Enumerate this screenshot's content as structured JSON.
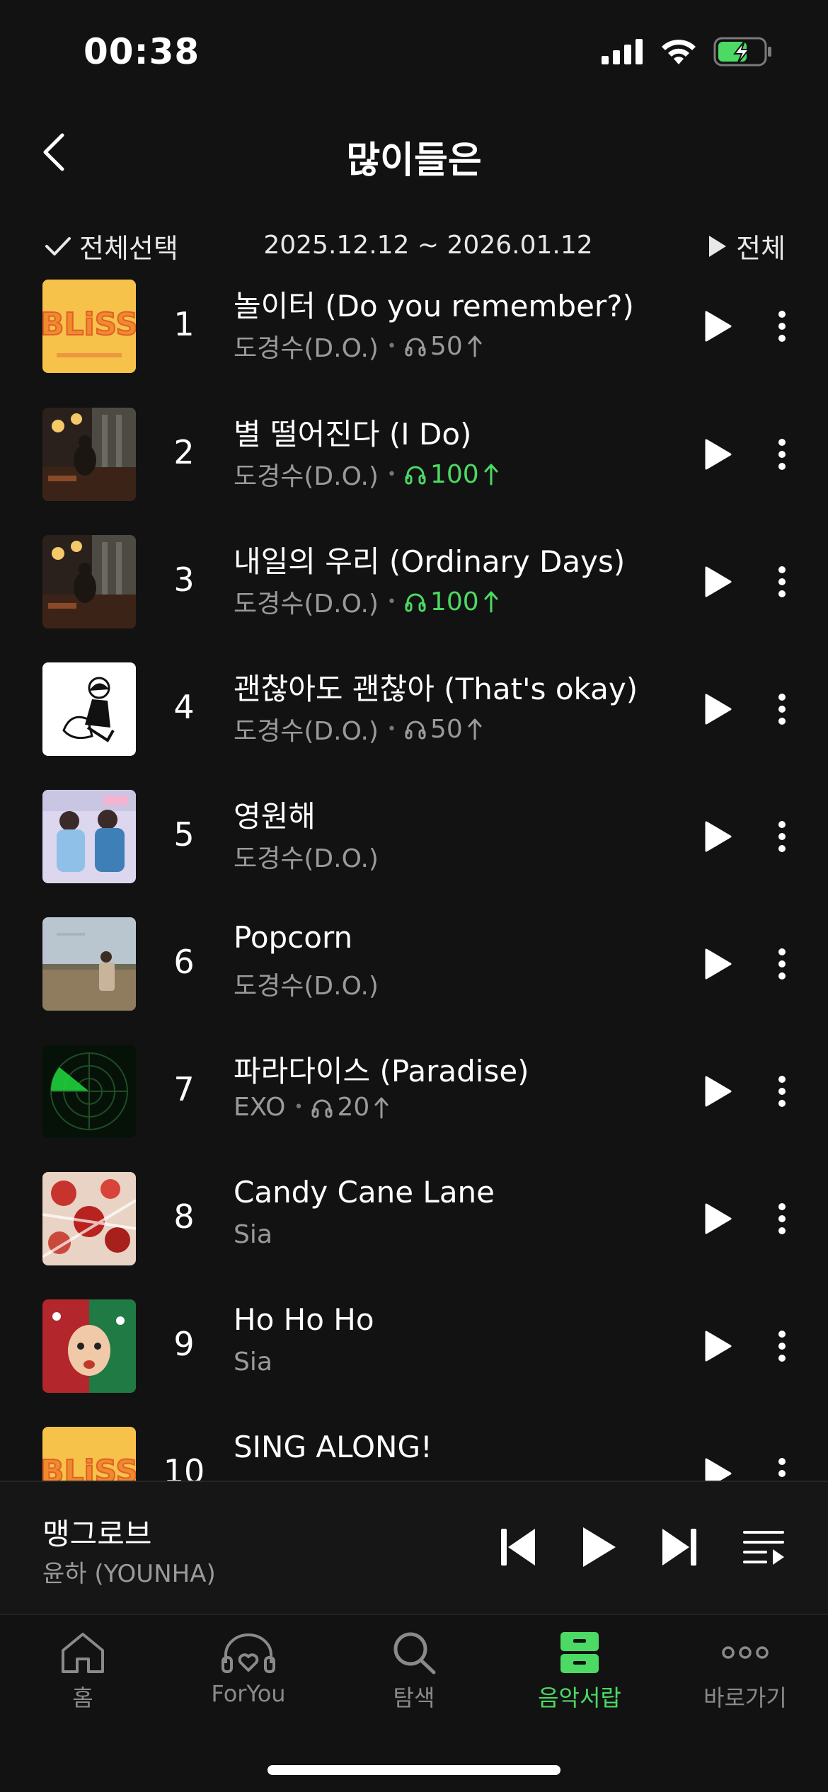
{
  "status_bar": {
    "time": "00:38"
  },
  "header": {
    "title": "많이들은"
  },
  "toolbar": {
    "select_all_label": "전체선택",
    "date_range": "2025.12.12 ~ 2026.01.12",
    "play_all_label": "전체"
  },
  "tracks": [
    {
      "rank": "1",
      "title": "놀이터 (Do you remember?)",
      "artist": "도경수(D.O.)",
      "plays": "50",
      "hot": false,
      "art": "bliss"
    },
    {
      "rank": "2",
      "title": "별 떨어진다 (I Do)",
      "artist": "도경수(D.O.)",
      "plays": "100",
      "hot": true,
      "art": "room"
    },
    {
      "rank": "3",
      "title": "내일의 우리 (Ordinary Days)",
      "artist": "도경수(D.O.)",
      "plays": "100",
      "hot": true,
      "art": "room"
    },
    {
      "rank": "4",
      "title": "괜찮아도 괜찮아 (That's okay)",
      "artist": "도경수(D.O.)",
      "plays": "50",
      "hot": false,
      "art": "sketch"
    },
    {
      "rank": "5",
      "title": "영원해",
      "artist": "도경수(D.O.)",
      "plays": "",
      "hot": false,
      "art": "drama"
    },
    {
      "rank": "6",
      "title": "Popcorn",
      "artist": "도경수(D.O.)",
      "plays": "",
      "hot": false,
      "art": "field"
    },
    {
      "rank": "7",
      "title": "파라다이스 (Paradise)",
      "artist": "EXO",
      "plays": "20",
      "hot": false,
      "art": "radar"
    },
    {
      "rank": "8",
      "title": "Candy Cane Lane",
      "artist": "Sia",
      "plays": "",
      "hot": false,
      "art": "candy"
    },
    {
      "rank": "9",
      "title": "Ho Ho Ho",
      "artist": "Sia",
      "plays": "",
      "hot": false,
      "art": "sia"
    },
    {
      "rank": "10",
      "title": "SING ALONG!",
      "artist": "",
      "plays": "",
      "hot": false,
      "art": "bliss"
    }
  ],
  "now_playing": {
    "title": "맹그로브",
    "artist": "윤하 (YOUNHA)"
  },
  "tabs": [
    {
      "label": "홈",
      "icon": "home-icon",
      "active": false
    },
    {
      "label": "ForYou",
      "icon": "heart-headphones-icon",
      "active": false
    },
    {
      "label": "탐색",
      "icon": "search-icon",
      "active": false
    },
    {
      "label": "음악서랍",
      "icon": "drawer-icon",
      "active": true
    },
    {
      "label": "바로가기",
      "icon": "more-dots-icon",
      "active": false
    }
  ],
  "colors": {
    "background": "#121212",
    "accent": "#4cd964",
    "secondary_text": "#9a9a9a"
  }
}
